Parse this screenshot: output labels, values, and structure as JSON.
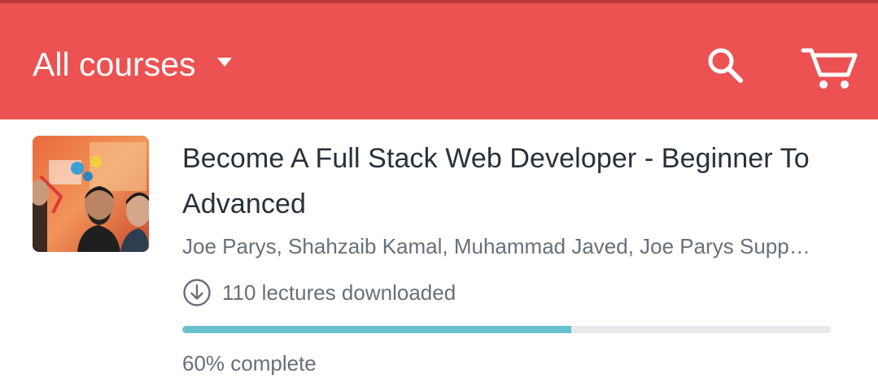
{
  "header": {
    "title": "All courses",
    "dropdown_icon": "caret-down-icon",
    "search_icon": "search-icon",
    "cart_icon": "cart-icon",
    "background_color": "#ec5252"
  },
  "course": {
    "title": "Become A Full Stack Web Developer - Beginner To Advanced",
    "authors": "Joe Parys, Shahzaib Kamal, Muhammad Javed, Joe Parys Supp…",
    "downloads_icon": "download-circle-icon",
    "downloads_text": "110 lectures downloaded",
    "progress_fraction": 0.6,
    "progress_color": "#69c1d0",
    "complete_text": "60% complete"
  }
}
